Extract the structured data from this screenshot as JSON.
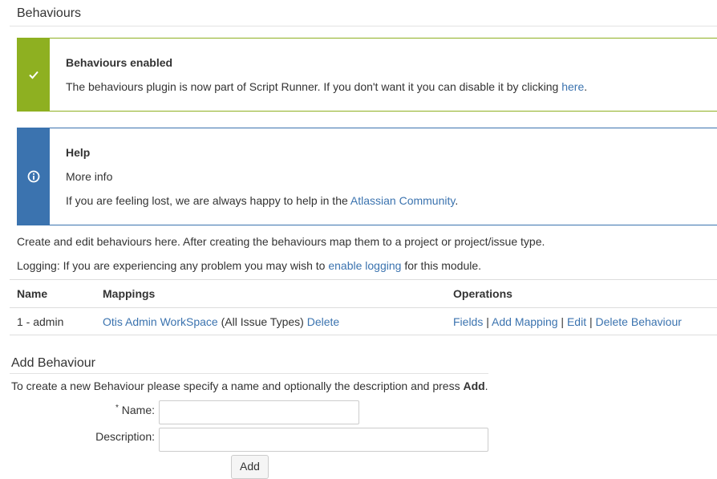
{
  "page": {
    "title": "Behaviours"
  },
  "success_message": {
    "icon": "check-icon",
    "title": "Behaviours enabled",
    "text": "The behaviours plugin is now part of Script Runner. If you don't want it you can disable it by clicking",
    "link": "here",
    "after_link": "."
  },
  "help_message": {
    "icon": "info-icon",
    "title": "Help",
    "more_info": "More info",
    "text": "If you are feeling lost, we are always happy to help in the",
    "link": "Atlassian Community",
    "after_link": "."
  },
  "intro": {
    "line1": "Create and edit behaviours here. After creating the behaviours map them to a project or project/issue type.",
    "line2_before": "Logging: If you are experiencing any problem you may wish to",
    "line2_link": "enable logging",
    "line2_after": "for this module."
  },
  "table": {
    "headers": {
      "name": "Name",
      "mappings": "Mappings",
      "operations": "Operations"
    },
    "rows": [
      {
        "name": "1 - admin",
        "mapping_link": "Otis Admin WorkSpace",
        "mapping_scope": "(All Issue Types)",
        "mapping_delete": "Delete",
        "ops": {
          "fields": "Fields",
          "add_mapping": "Add Mapping",
          "edit": "Edit",
          "delete_behaviour": "Delete Behaviour",
          "separator": "|"
        }
      }
    ]
  },
  "add_section": {
    "title": "Add Behaviour",
    "desc_before": "To create a new Behaviour please specify a name and optionally the description and press",
    "desc_bold": "Add",
    "desc_after": ".",
    "name_required": "*",
    "name_label": "Name:",
    "name_value": "",
    "description_label": "Description:",
    "description_value": "",
    "button": "Add"
  },
  "colors": {
    "success": "#8eb021",
    "info": "#3b73af",
    "link": "#3b73af"
  }
}
